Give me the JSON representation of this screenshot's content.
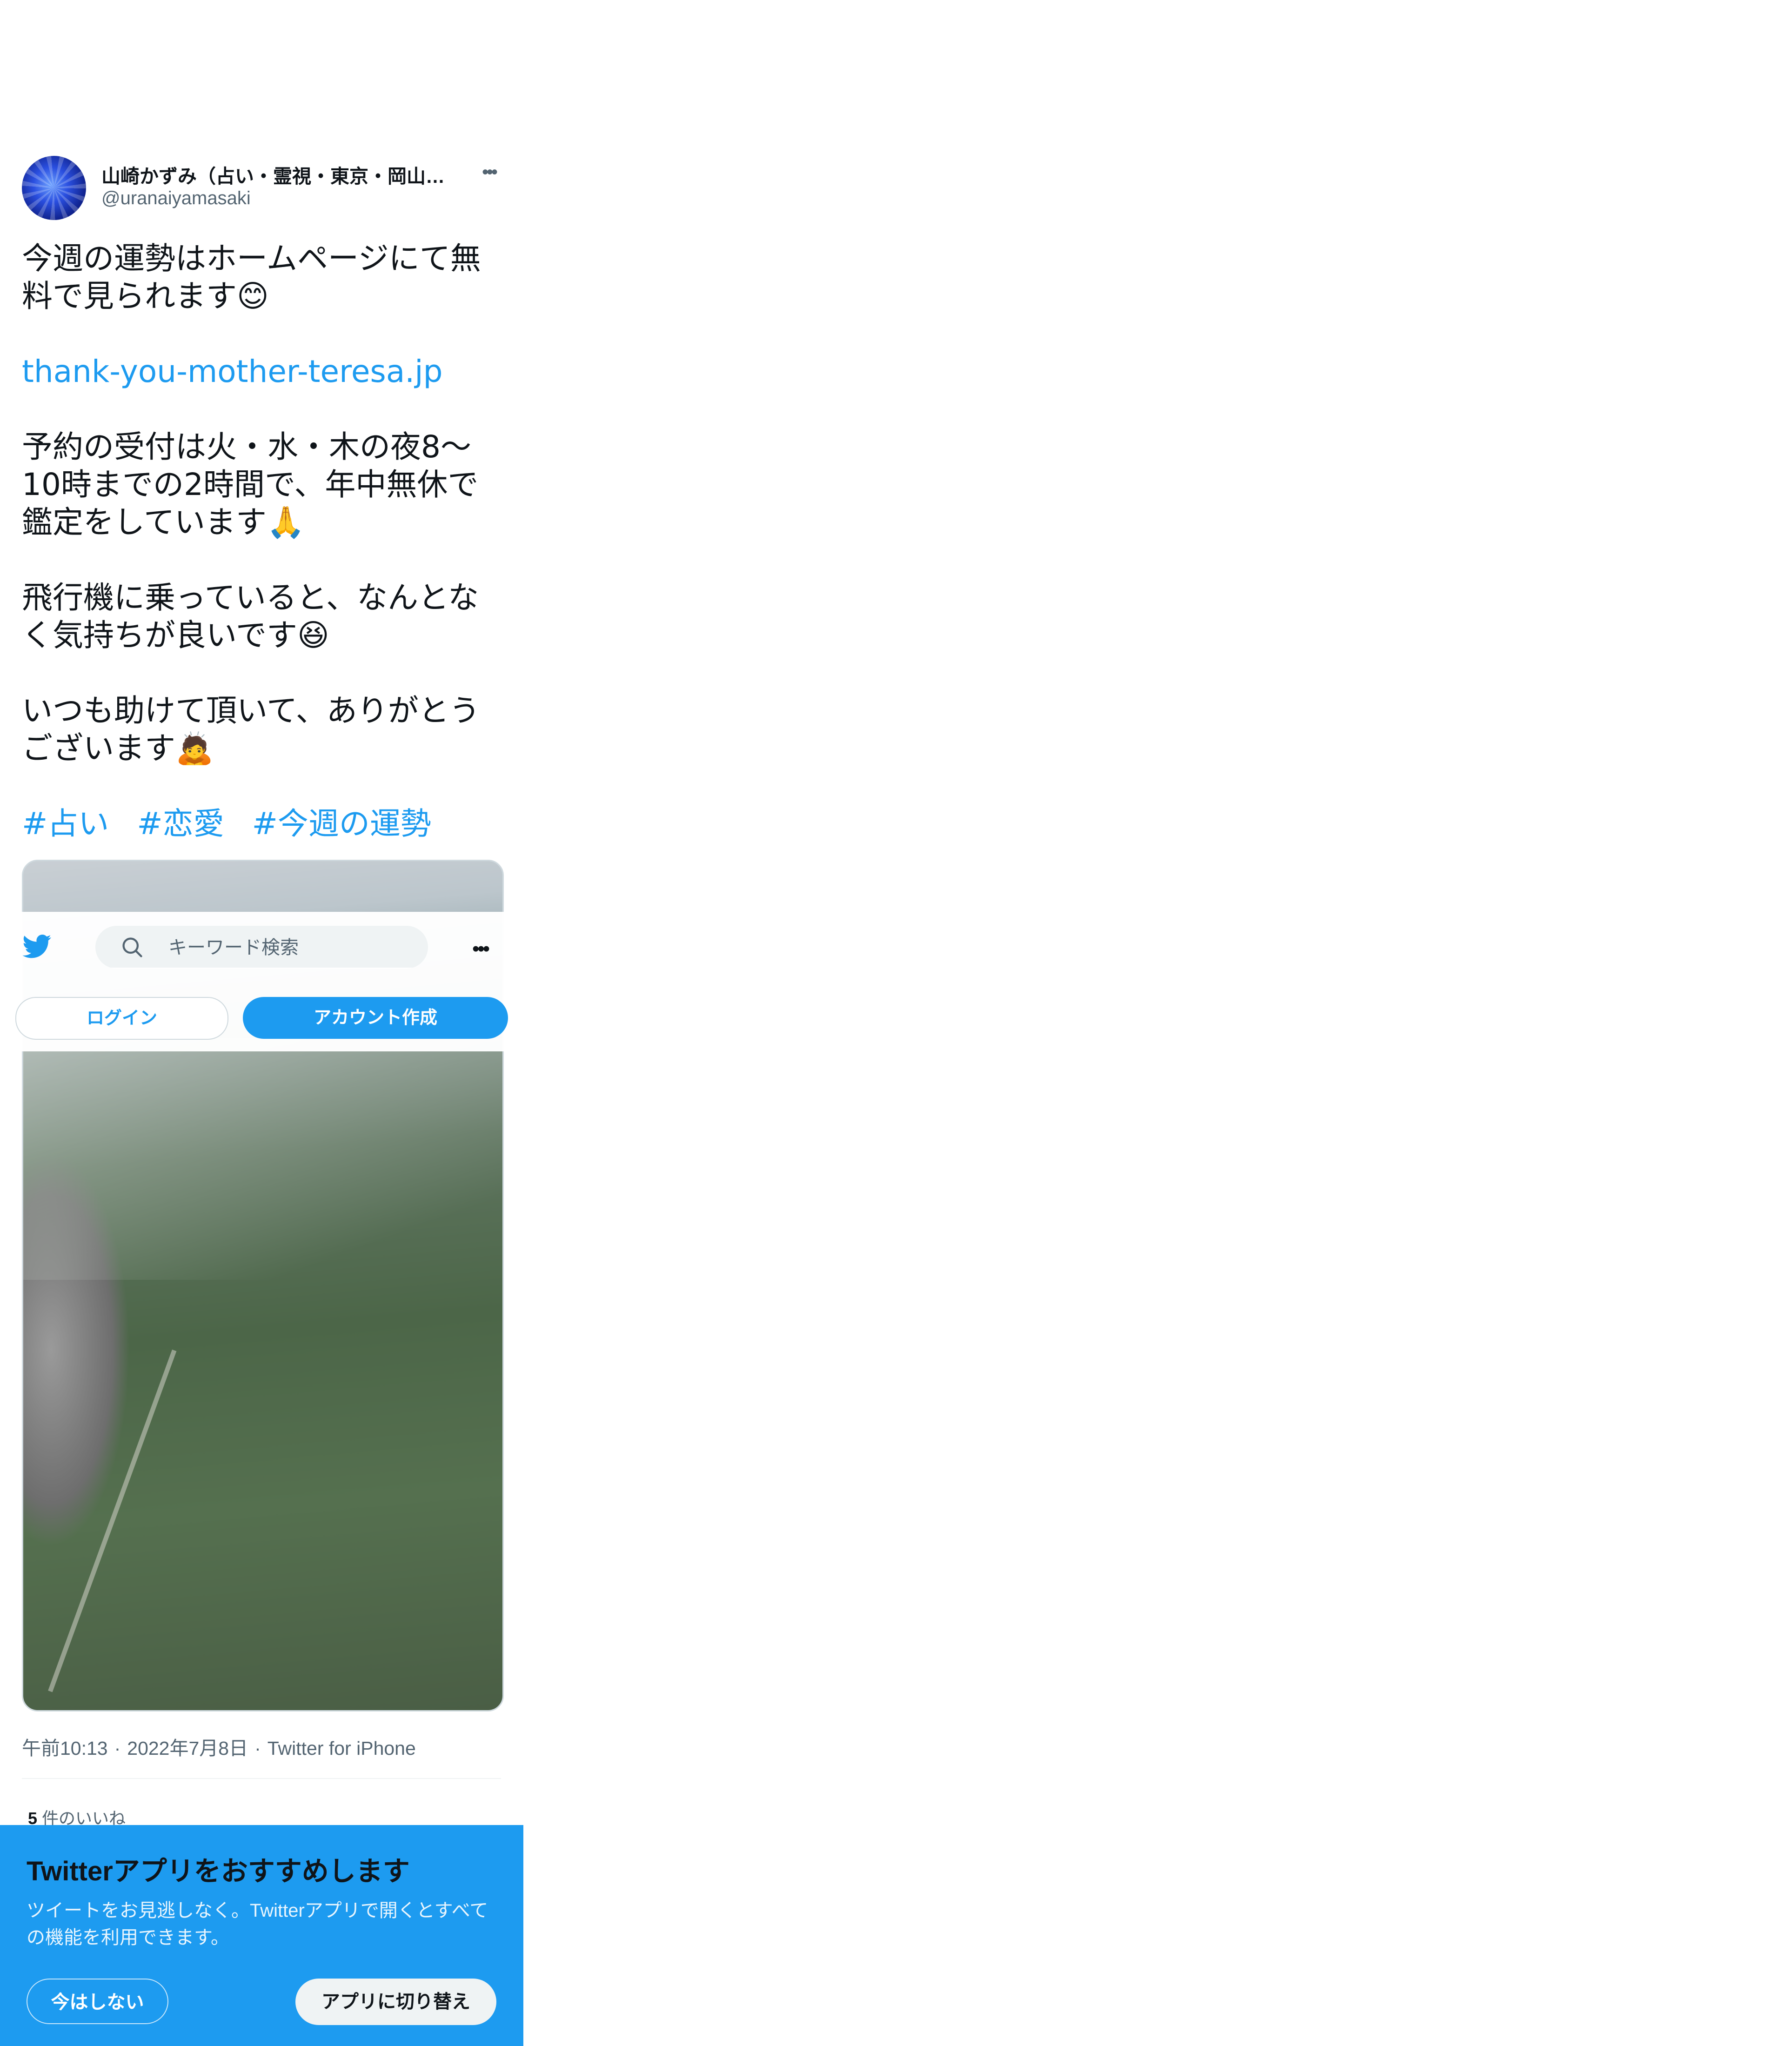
{
  "tweet": {
    "display_name": "山崎かずみ（占い・霊視・東京・岡山…",
    "handle": "@uranaiyamasaki",
    "more_icon": "more-horizontal-icon",
    "text_lines": [
      "今週の運勢はホームページにて無料で見られます😊",
      "thank-you-mother-teresa.jp",
      "予約の受付は火・水・木の夜8〜10時までの2時間で、年中無休で鑑定をしています🙏",
      "飛行機に乗っていると、なんとなく気持ちが良いです😆",
      "いつも助けて頂いて、ありがとうございます🙇"
    ],
    "hashtags": [
      "#占い",
      "#恋愛",
      "#今週の運勢"
    ],
    "image_alt": "",
    "time": "午前10:13",
    "date": "2022年7月8日",
    "source": "Twitter for iPhone",
    "likes_count": "5",
    "likes_label": "件のいいね"
  },
  "topbar": {
    "search_placeholder": "キーワード検索",
    "login_label": "ログイン",
    "signup_label": "アカウント作成"
  },
  "app_banner": {
    "title": "Twitterアプリをおすすめします",
    "body": "ツイートをお見逃しなく。Twitterアプリで開くとすべての機能を利用できます。",
    "not_now_label": "今はしない",
    "switch_label": "アプリに切り替え"
  },
  "colors": {
    "accent": "#1d9bf0",
    "text": "#0f1419",
    "secondary_text": "#536471"
  }
}
